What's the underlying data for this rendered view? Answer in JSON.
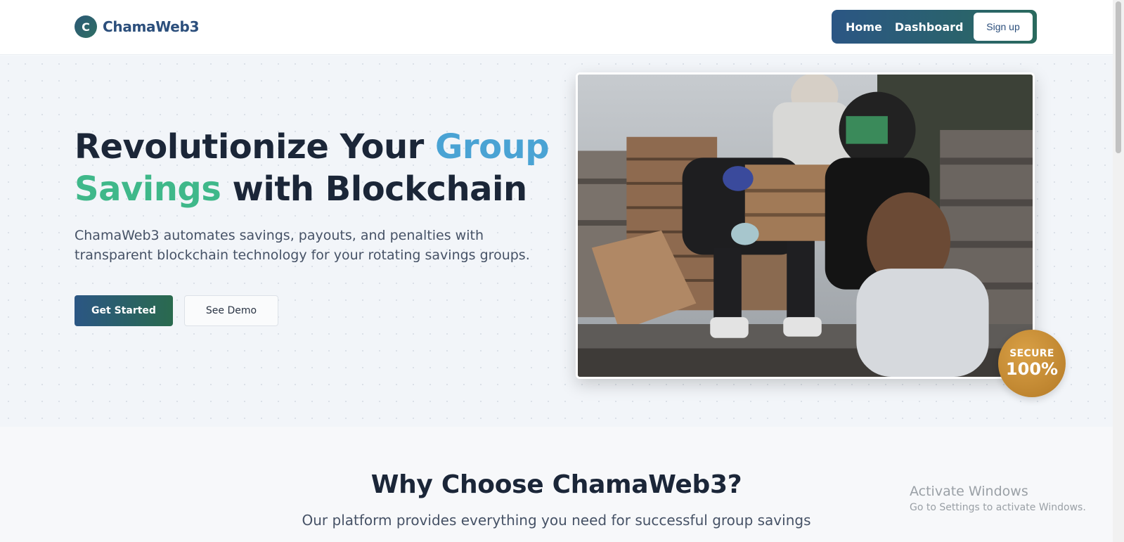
{
  "brand": {
    "logo_letter": "C",
    "name": "ChamaWeb3"
  },
  "nav": {
    "items": [
      "Home",
      "Dashboard"
    ],
    "signup_label": "Sign up"
  },
  "hero": {
    "title_part1": "Revolutionize Your ",
    "title_highlight1": "Group",
    "title_highlight2": "Savings",
    "title_part2": " with Blockchain",
    "subtitle": "ChamaWeb3 automates savings, payouts, and penalties with transparent blockchain technology for your rotating savings groups.",
    "primary_button": "Get Started",
    "secondary_button": "See Demo",
    "badge": {
      "label": "SECURE",
      "value": "100%"
    }
  },
  "features": {
    "title": "Why Choose ChamaWeb3?",
    "subtitle": "Our platform provides everything you need for successful group savings"
  },
  "watermark": {
    "title": "Activate Windows",
    "subtitle": "Go to Settings to activate Windows."
  },
  "colors": {
    "brand_blue": "#2b5684",
    "brand_green": "#2a6a5e",
    "highlight_blue": "#4aa3d4",
    "highlight_green": "#3fb88a",
    "badge_gold": "#c48a30"
  }
}
